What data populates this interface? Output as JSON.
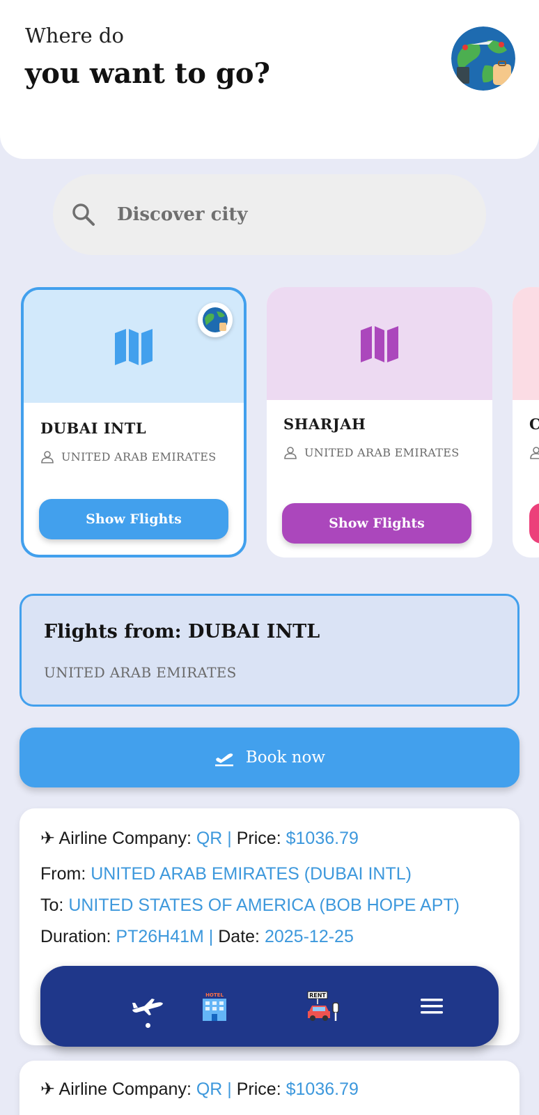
{
  "header": {
    "line1": "Where do",
    "line2": "you want to go?"
  },
  "search": {
    "placeholder": "Discover city"
  },
  "cards": [
    {
      "title": "DUBAI INTL",
      "country": "UNITED ARAB EMIRATES",
      "button": "Show Flights",
      "color": "#42a0ed",
      "tint": "#d2e9fb"
    },
    {
      "title": "SHARJAH",
      "country": "UNITED ARAB EMIRATES",
      "button": "Show Flights",
      "color": "#ab47bc",
      "tint": "#eddaf2"
    },
    {
      "title": "C",
      "country": "",
      "button": "",
      "color": "#ec407a",
      "tint": "#fbdce4"
    }
  ],
  "selected": {
    "title": "Flights from: DUBAI INTL",
    "subtitle": "UNITED ARAB EMIRATES"
  },
  "book_button": "Book now",
  "flights": [
    {
      "airline_label": "Airline Company:",
      "airline": "QR |",
      "price_label": "Price:",
      "price": "$1036.79",
      "from_label": "From:",
      "from": "UNITED ARAB EMIRATES (DUBAI INTL)",
      "to_label": "To:",
      "to": "UNITED STATES OF AMERICA (BOB HOPE APT)",
      "duration_label": "Duration:",
      "duration": "PT26H41M |",
      "date_label": "Date:",
      "date": "2025-12-25"
    },
    {
      "airline_label": "Airline Company:",
      "airline": "QR |",
      "price_label": "Price:",
      "price": "$1036.79"
    }
  ],
  "nav": {
    "items": [
      "airplane-icon",
      "hotel-icon",
      "car-rental-icon",
      "menu-icon"
    ],
    "hotel_sign": "HOTEL",
    "rent_sign": "RENT",
    "active_index": 0
  },
  "colors": {
    "accent": "#42a0ed",
    "purple": "#ab47bc",
    "navy": "#1f378a",
    "background": "#e8eaf6"
  }
}
